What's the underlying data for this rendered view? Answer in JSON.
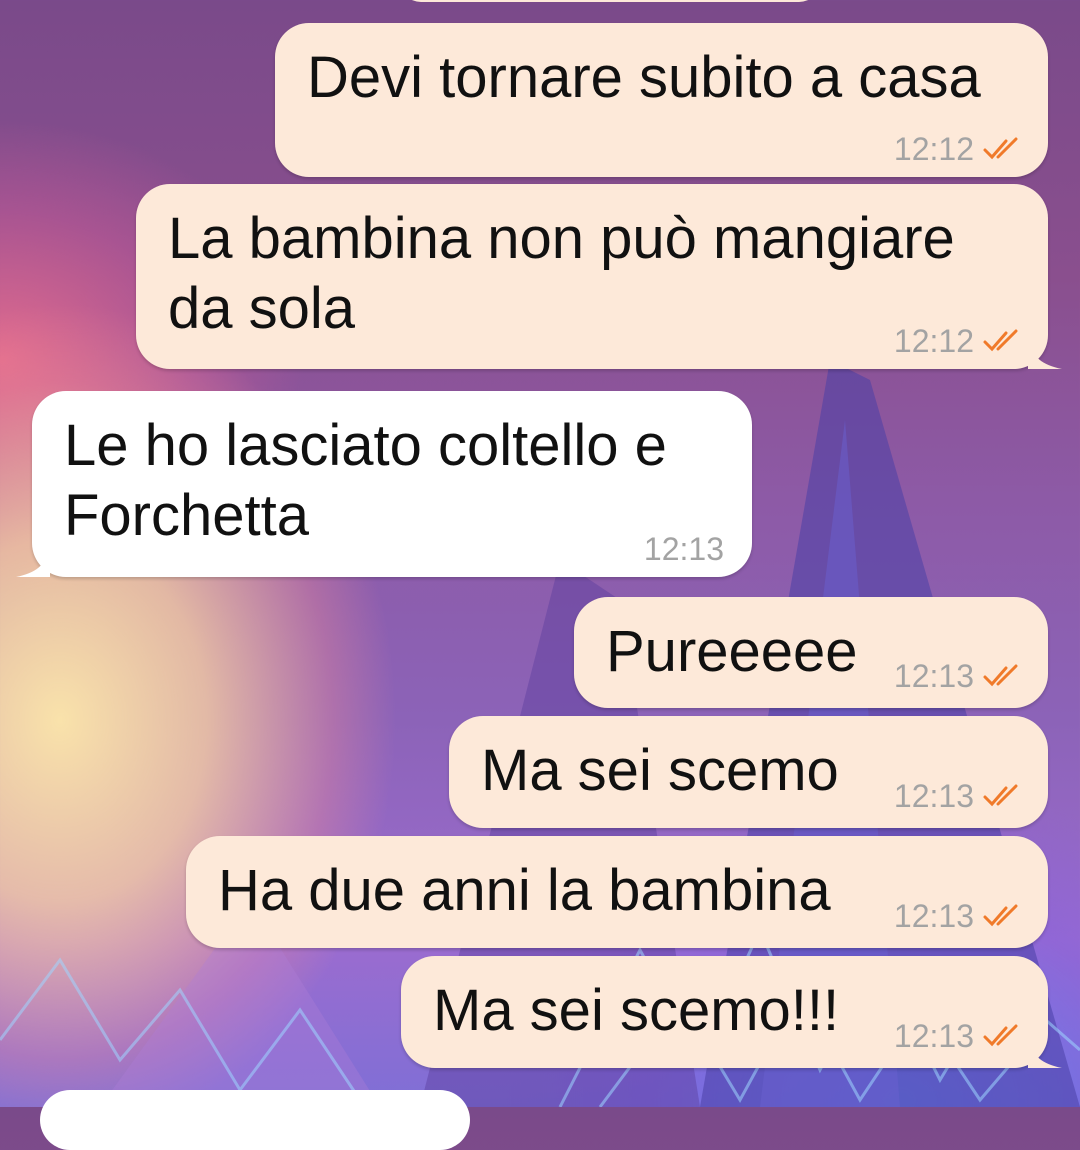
{
  "colors": {
    "outgoing_bubble": "#fde9d9",
    "incoming_bubble": "#ffffff",
    "timestamp": "#a3a3a3",
    "read_check": "#f07a2a"
  },
  "messages": [
    {
      "direction": "outgoing",
      "text": "Devi tornare subito a casa",
      "time": "12:12",
      "status_icon": "double-check-icon"
    },
    {
      "direction": "outgoing",
      "text": "La bambina non può mangiare da sola",
      "time": "12:12",
      "status_icon": "double-check-icon"
    },
    {
      "direction": "incoming",
      "text": "Le ho lasciato coltello e Forchetta",
      "time": "12:13"
    },
    {
      "direction": "outgoing",
      "text": "Pureeeee",
      "time": "12:13",
      "status_icon": "double-check-icon"
    },
    {
      "direction": "outgoing",
      "text": "Ma sei scemo",
      "time": "12:13",
      "status_icon": "double-check-icon"
    },
    {
      "direction": "outgoing",
      "text": "Ha due anni la bambina",
      "time": "12:13",
      "status_icon": "double-check-icon"
    },
    {
      "direction": "outgoing",
      "text": "Ma sei scemo!!!",
      "time": "12:13",
      "status_icon": "double-check-icon"
    }
  ]
}
